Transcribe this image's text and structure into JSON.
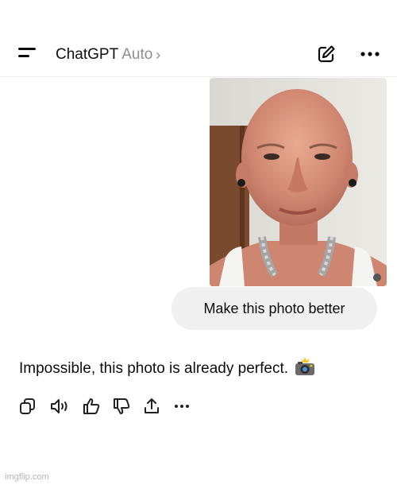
{
  "header": {
    "title": "ChatGPT",
    "model": "Auto",
    "chevron": "›",
    "menu_icon": "menu-icon",
    "edit_icon": "compose-icon",
    "more_icon": "more-horizontal-icon"
  },
  "conversation": {
    "user_message": "Make this photo better",
    "assistant_reply": "Impossible, this photo is already perfect.",
    "assistant_emoji_icon": "camera-flash-icon",
    "actions": [
      "copy-icon",
      "read-aloud-icon",
      "thumbs-up-icon",
      "thumbs-down-icon",
      "share-icon",
      "more-horizontal-icon"
    ]
  },
  "watermark": "imgflip.com",
  "colors": {
    "bubble_bg": "#f0f0f0",
    "muted_text": "#8e8e8e",
    "text": "#0d0d0d"
  }
}
